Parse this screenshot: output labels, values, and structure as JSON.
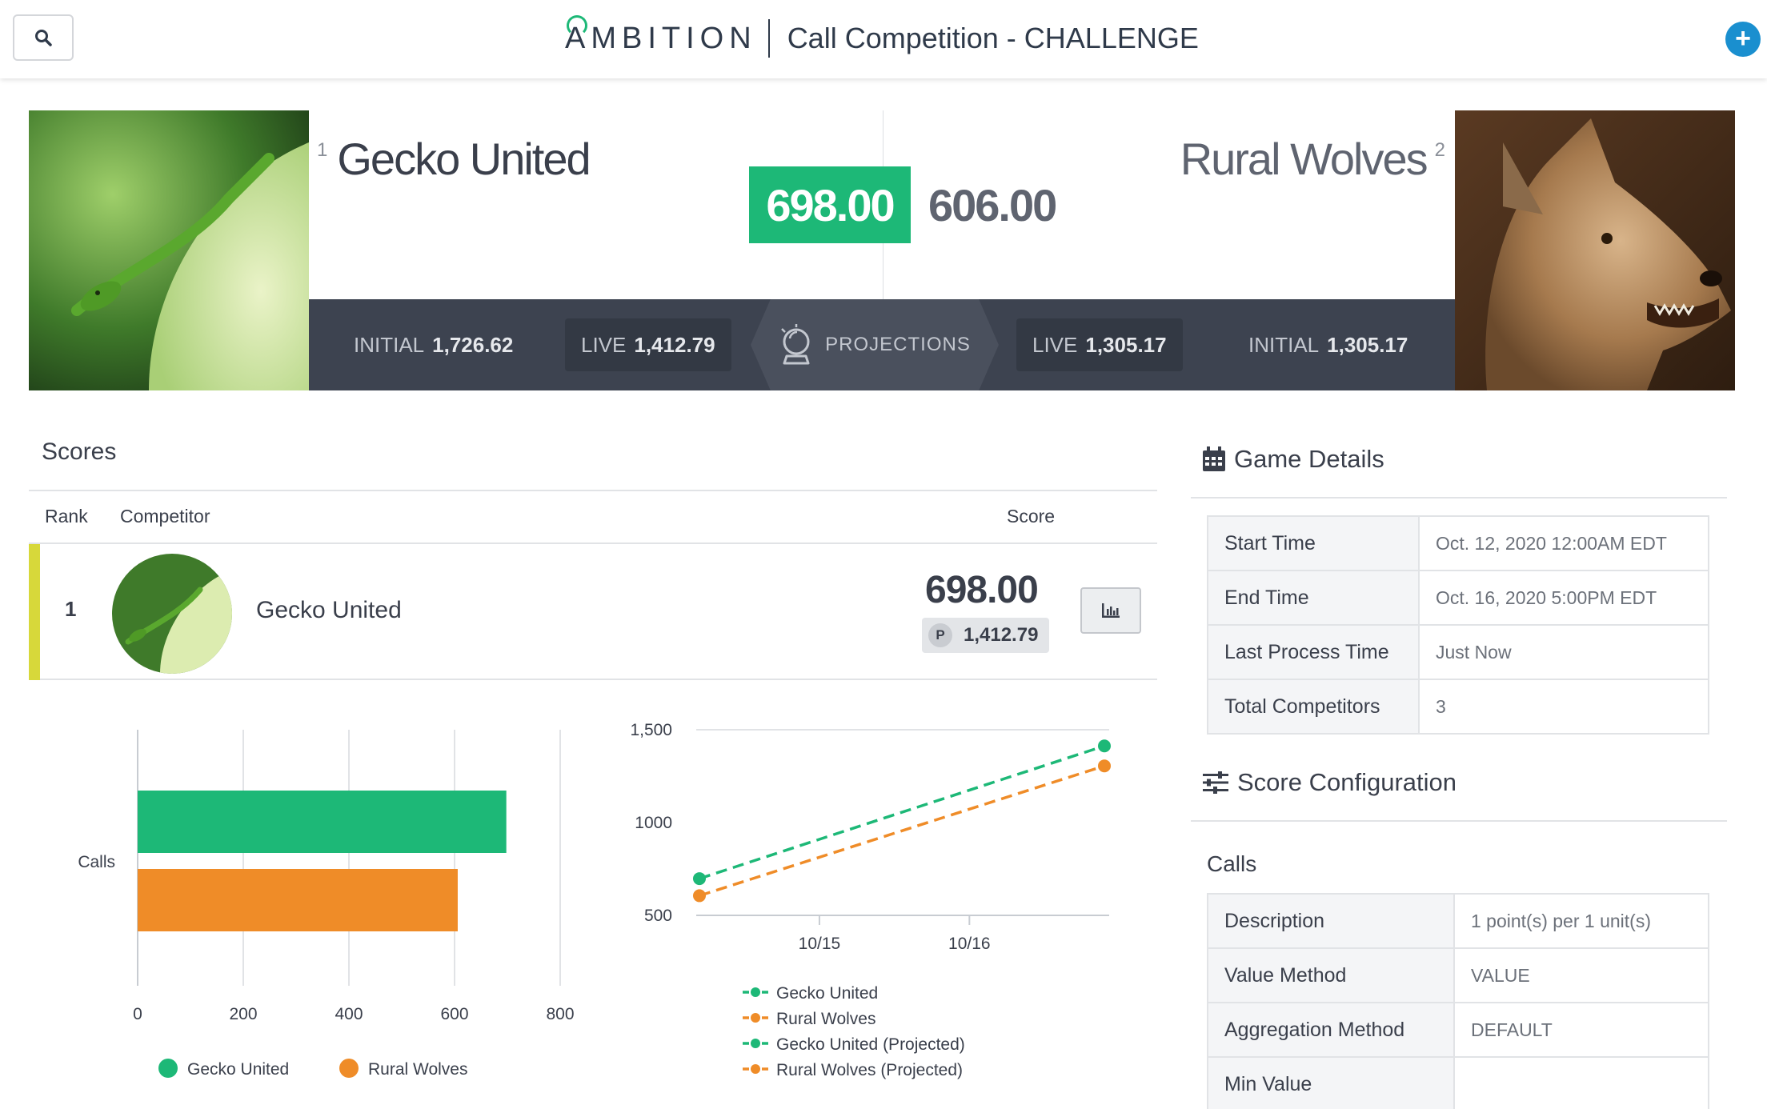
{
  "header": {
    "brand": "MBITION",
    "brand_first": "A",
    "title": "Call Competition - CHALLENGE",
    "add_label": "+"
  },
  "hero": {
    "left": {
      "rank": "1",
      "name": "Gecko United",
      "score": "698.00",
      "initial_label": "INITIAL",
      "initial": "1,726.62",
      "live_label": "LIVE",
      "live": "1,412.79"
    },
    "right": {
      "rank": "2",
      "name": "Rural Wolves",
      "score": "606.00",
      "initial_label": "INITIAL",
      "initial": "1,305.17",
      "live_label": "LIVE",
      "live": "1,305.17"
    },
    "projections_label": "PROJECTIONS"
  },
  "scores": {
    "title": "Scores",
    "columns": {
      "rank": "Rank",
      "competitor": "Competitor",
      "score": "Score"
    },
    "rows": [
      {
        "rank": "1",
        "name": "Gecko United",
        "score": "698.00",
        "projection_badge": "P",
        "projection": "1,412.79"
      }
    ]
  },
  "chart_data": [
    {
      "type": "bar",
      "orientation": "horizontal",
      "categories": [
        "Calls"
      ],
      "series": [
        {
          "name": "Gecko United",
          "values": [
            698
          ],
          "color": "#1db877"
        },
        {
          "name": "Rural Wolves",
          "values": [
            606
          ],
          "color": "#ef8c28"
        }
      ],
      "xticks": [
        "0",
        "200",
        "400",
        "600",
        "800"
      ],
      "xlim": [
        0,
        800
      ],
      "legend": "bottom"
    },
    {
      "type": "line",
      "xticks": [
        "10/15",
        "10/16"
      ],
      "yticks": [
        "1,500",
        "1000",
        "500"
      ],
      "ylim": [
        500,
        1500
      ],
      "x_days": [
        14.2,
        16.9
      ],
      "series": [
        {
          "name": "Gecko United",
          "color": "#1db877",
          "style": "dashed",
          "values": [
            698,
            1412.79
          ]
        },
        {
          "name": "Rural Wolves",
          "color": "#ef8c28",
          "style": "dashed",
          "values": [
            606,
            1305.17
          ]
        }
      ],
      "legend_entries": [
        {
          "name": "Gecko United",
          "color": "#1db877"
        },
        {
          "name": "Rural Wolves",
          "color": "#ef8c28"
        },
        {
          "name": "Gecko United (Projected)",
          "color": "#1db877"
        },
        {
          "name": "Rural Wolves (Projected)",
          "color": "#ef8c28"
        }
      ],
      "legend": "bottom"
    }
  ],
  "game_details": {
    "title": "Game Details",
    "rows": [
      {
        "key": "Start Time",
        "value": "Oct. 12, 2020 12:00AM EDT"
      },
      {
        "key": "End Time",
        "value": "Oct. 16, 2020 5:00PM EDT"
      },
      {
        "key": "Last Process Time",
        "value": "Just Now"
      },
      {
        "key": "Total Competitors",
        "value": "3"
      }
    ]
  },
  "score_config": {
    "title": "Score Configuration",
    "section": "Calls",
    "rows": [
      {
        "key": "Description",
        "value": "1  point(s) per 1 unit(s)"
      },
      {
        "key": "Value Method",
        "value": "VALUE"
      },
      {
        "key": "Aggregation Method",
        "value": "DEFAULT"
      },
      {
        "key": "Min Value",
        "value": ""
      }
    ]
  }
}
